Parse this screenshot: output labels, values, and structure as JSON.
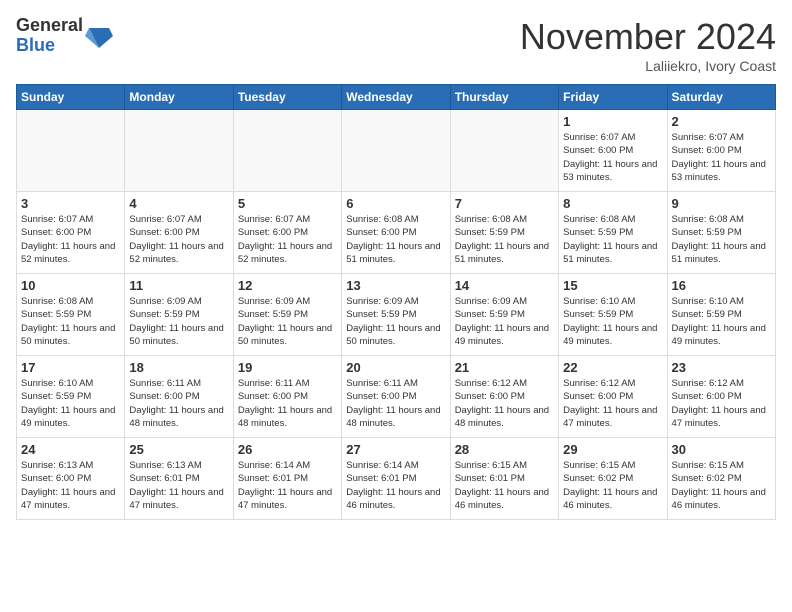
{
  "header": {
    "logo_general": "General",
    "logo_blue": "Blue",
    "month_title": "November 2024",
    "location": "Laliiekro, Ivory Coast"
  },
  "days_of_week": [
    "Sunday",
    "Monday",
    "Tuesday",
    "Wednesday",
    "Thursday",
    "Friday",
    "Saturday"
  ],
  "weeks": [
    [
      {
        "day": "",
        "info": ""
      },
      {
        "day": "",
        "info": ""
      },
      {
        "day": "",
        "info": ""
      },
      {
        "day": "",
        "info": ""
      },
      {
        "day": "",
        "info": ""
      },
      {
        "day": "1",
        "info": "Sunrise: 6:07 AM\nSunset: 6:00 PM\nDaylight: 11 hours and 53 minutes."
      },
      {
        "day": "2",
        "info": "Sunrise: 6:07 AM\nSunset: 6:00 PM\nDaylight: 11 hours and 53 minutes."
      }
    ],
    [
      {
        "day": "3",
        "info": "Sunrise: 6:07 AM\nSunset: 6:00 PM\nDaylight: 11 hours and 52 minutes."
      },
      {
        "day": "4",
        "info": "Sunrise: 6:07 AM\nSunset: 6:00 PM\nDaylight: 11 hours and 52 minutes."
      },
      {
        "day": "5",
        "info": "Sunrise: 6:07 AM\nSunset: 6:00 PM\nDaylight: 11 hours and 52 minutes."
      },
      {
        "day": "6",
        "info": "Sunrise: 6:08 AM\nSunset: 6:00 PM\nDaylight: 11 hours and 51 minutes."
      },
      {
        "day": "7",
        "info": "Sunrise: 6:08 AM\nSunset: 5:59 PM\nDaylight: 11 hours and 51 minutes."
      },
      {
        "day": "8",
        "info": "Sunrise: 6:08 AM\nSunset: 5:59 PM\nDaylight: 11 hours and 51 minutes."
      },
      {
        "day": "9",
        "info": "Sunrise: 6:08 AM\nSunset: 5:59 PM\nDaylight: 11 hours and 51 minutes."
      }
    ],
    [
      {
        "day": "10",
        "info": "Sunrise: 6:08 AM\nSunset: 5:59 PM\nDaylight: 11 hours and 50 minutes."
      },
      {
        "day": "11",
        "info": "Sunrise: 6:09 AM\nSunset: 5:59 PM\nDaylight: 11 hours and 50 minutes."
      },
      {
        "day": "12",
        "info": "Sunrise: 6:09 AM\nSunset: 5:59 PM\nDaylight: 11 hours and 50 minutes."
      },
      {
        "day": "13",
        "info": "Sunrise: 6:09 AM\nSunset: 5:59 PM\nDaylight: 11 hours and 50 minutes."
      },
      {
        "day": "14",
        "info": "Sunrise: 6:09 AM\nSunset: 5:59 PM\nDaylight: 11 hours and 49 minutes."
      },
      {
        "day": "15",
        "info": "Sunrise: 6:10 AM\nSunset: 5:59 PM\nDaylight: 11 hours and 49 minutes."
      },
      {
        "day": "16",
        "info": "Sunrise: 6:10 AM\nSunset: 5:59 PM\nDaylight: 11 hours and 49 minutes."
      }
    ],
    [
      {
        "day": "17",
        "info": "Sunrise: 6:10 AM\nSunset: 5:59 PM\nDaylight: 11 hours and 49 minutes."
      },
      {
        "day": "18",
        "info": "Sunrise: 6:11 AM\nSunset: 6:00 PM\nDaylight: 11 hours and 48 minutes."
      },
      {
        "day": "19",
        "info": "Sunrise: 6:11 AM\nSunset: 6:00 PM\nDaylight: 11 hours and 48 minutes."
      },
      {
        "day": "20",
        "info": "Sunrise: 6:11 AM\nSunset: 6:00 PM\nDaylight: 11 hours and 48 minutes."
      },
      {
        "day": "21",
        "info": "Sunrise: 6:12 AM\nSunset: 6:00 PM\nDaylight: 11 hours and 48 minutes."
      },
      {
        "day": "22",
        "info": "Sunrise: 6:12 AM\nSunset: 6:00 PM\nDaylight: 11 hours and 47 minutes."
      },
      {
        "day": "23",
        "info": "Sunrise: 6:12 AM\nSunset: 6:00 PM\nDaylight: 11 hours and 47 minutes."
      }
    ],
    [
      {
        "day": "24",
        "info": "Sunrise: 6:13 AM\nSunset: 6:00 PM\nDaylight: 11 hours and 47 minutes."
      },
      {
        "day": "25",
        "info": "Sunrise: 6:13 AM\nSunset: 6:01 PM\nDaylight: 11 hours and 47 minutes."
      },
      {
        "day": "26",
        "info": "Sunrise: 6:14 AM\nSunset: 6:01 PM\nDaylight: 11 hours and 47 minutes."
      },
      {
        "day": "27",
        "info": "Sunrise: 6:14 AM\nSunset: 6:01 PM\nDaylight: 11 hours and 46 minutes."
      },
      {
        "day": "28",
        "info": "Sunrise: 6:15 AM\nSunset: 6:01 PM\nDaylight: 11 hours and 46 minutes."
      },
      {
        "day": "29",
        "info": "Sunrise: 6:15 AM\nSunset: 6:02 PM\nDaylight: 11 hours and 46 minutes."
      },
      {
        "day": "30",
        "info": "Sunrise: 6:15 AM\nSunset: 6:02 PM\nDaylight: 11 hours and 46 minutes."
      }
    ]
  ]
}
